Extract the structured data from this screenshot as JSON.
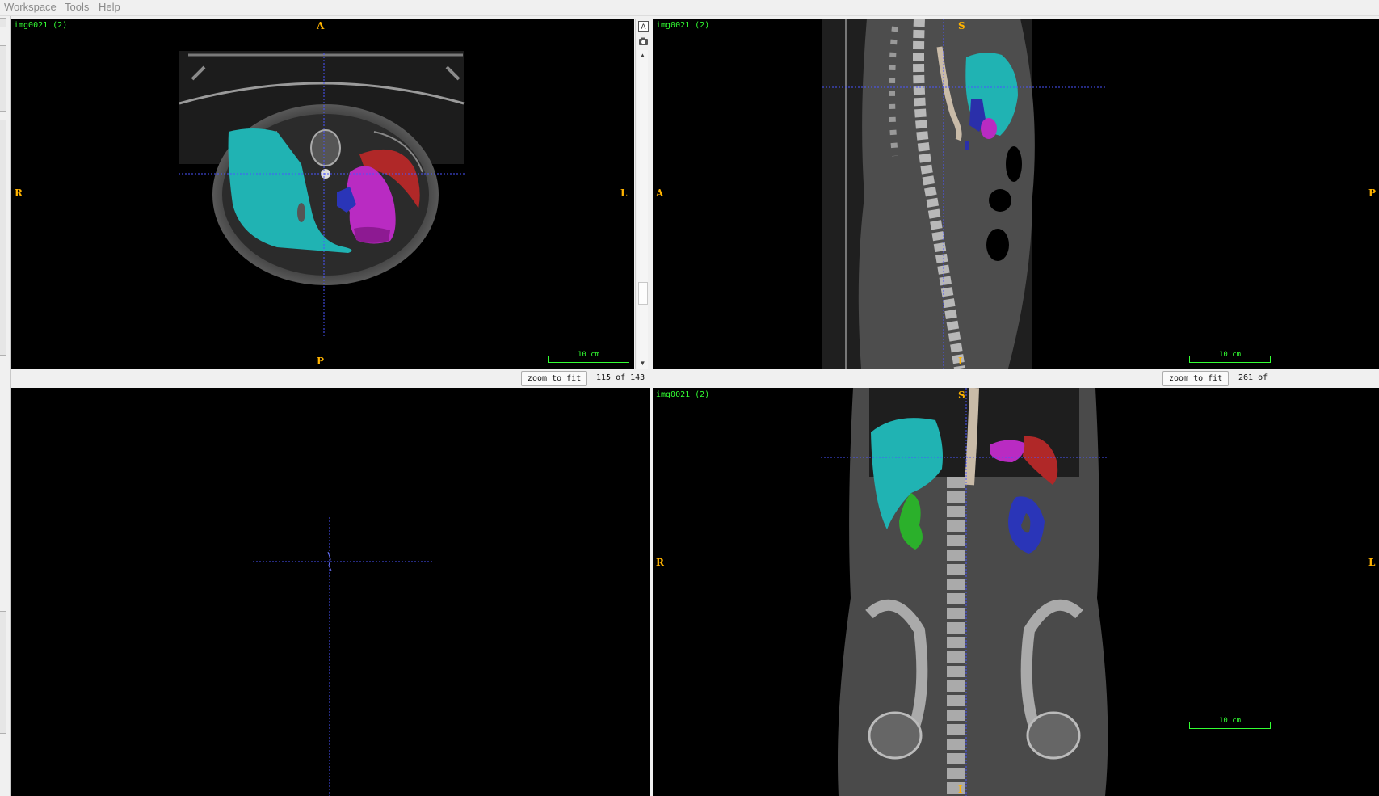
{
  "menu": {
    "items": [
      "Workspace",
      "Tools",
      "Help"
    ]
  },
  "colors": {
    "liver": "#20b3b3",
    "spleen": "#b02828",
    "stomach": "#b92bc2",
    "stomach_dark": "#8d1a92",
    "kidney_left": "#2a35b8",
    "kidney_right": "#2bb02b",
    "aorta": "#c9bba8",
    "pancreas": "#2a2faa",
    "crosshair": "#4a55ff",
    "overlay_text": "#33ff33",
    "orientation": "#ffb300"
  },
  "views": {
    "axial": {
      "image_label": "img0021 (2)",
      "orientation": {
        "top": "A",
        "bottom": "P",
        "left": "R",
        "right": "L"
      },
      "scale_bar": "10 cm",
      "zoom_button": "zoom to fit",
      "slice_readout": "115 of 143"
    },
    "sagittal": {
      "image_label": "img0021 (2)",
      "orientation": {
        "top": "S",
        "bottom": "I",
        "left": "A",
        "right": "P"
      },
      "scale_bar": "10 cm",
      "zoom_button": "zoom to fit",
      "slice_readout": "261 of"
    },
    "coronal": {
      "image_label": "img0021 (2)",
      "orientation": {
        "top": "S",
        "bottom": "I",
        "left": "R",
        "right": "L"
      },
      "scale_bar": "10 cm"
    }
  },
  "toolbar": {
    "icons": [
      "annotation-icon",
      "camera-icon"
    ]
  }
}
